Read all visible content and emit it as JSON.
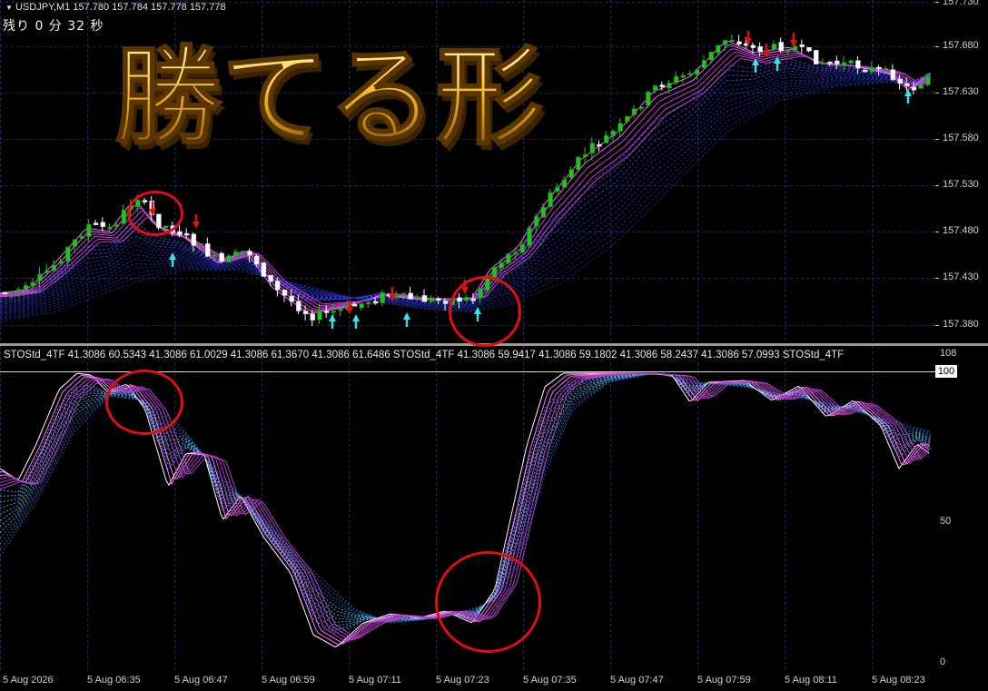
{
  "window": {
    "symbol_info": "USDJPY,M1  157.780 157.784 157.778 157.778",
    "countdown": "残り 0 分 32 秒",
    "promo_text": "勝てる形"
  },
  "price_axis": {
    "labels": [
      "157.730",
      "157.680",
      "157.630",
      "157.580",
      "157.530",
      "157.480",
      "157.430",
      "157.380"
    ]
  },
  "indicator": {
    "header": "STOStd_4TF 41.3086 60.5343 41.3086 61.0029 41.3086 61.3670 41.3086 61.6486  STOStd_4TF 41.3086 59.9417 41.3086 59.1802 41.3086 58.2437 41.3086 57.0993  STOStd_4TF",
    "axis": {
      "top": "108",
      "hundred": "100",
      "fifty": "50",
      "zero": "0"
    }
  },
  "time_axis": {
    "labels": [
      "5 Aug 2026",
      "5 Aug 06:35",
      "5 Aug 06:47",
      "5 Aug 06:59",
      "5 Aug 07:11",
      "5 Aug 07:23",
      "5 Aug 07:35",
      "5 Aug 07:47",
      "5 Aug 07:59",
      "5 Aug 08:11",
      "5 Aug 08:23"
    ]
  },
  "colors": {
    "background": "#000000",
    "grid": "#1e2a66",
    "bull_candle": "#22c022",
    "bear_candle": "#ffffff",
    "buy_arrow": "#36e6e6",
    "sell_arrow": "#e21010",
    "ribbon_fast": "#ff40ff",
    "ribbon_slow": "#2a3cff",
    "highlight": "#e01010"
  }
}
